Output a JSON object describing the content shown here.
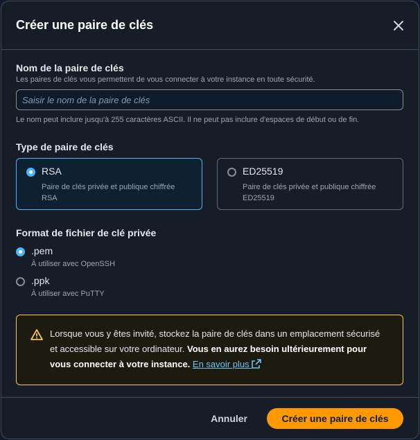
{
  "modal": {
    "title": "Créer une paire de clés"
  },
  "name_field": {
    "label": "Nom de la paire de clés",
    "description": "Les paires de clés vous permettent de vous connecter à votre instance en toute sécurité.",
    "placeholder": "Saisir le nom de la paire de clés",
    "value": "",
    "constraint": "Le nom peut inclure jusqu'à 255 caractères ASCII. Il ne peut pas inclure d'espaces de début ou de fin."
  },
  "key_type": {
    "label": "Type de paire de clés",
    "options": [
      {
        "title": "RSA",
        "desc_line1": "Paire de clés privée et publique chiffrée",
        "desc_line2": "RSA",
        "selected": true
      },
      {
        "title": "ED25519",
        "desc_line1": "Paire de clés privée et publique chiffrée",
        "desc_line2": "ED25519",
        "selected": false
      }
    ]
  },
  "file_format": {
    "label": "Format de fichier de clé privée",
    "options": [
      {
        "title": ".pem",
        "desc": "À utiliser avec OpenSSH",
        "selected": true
      },
      {
        "title": ".ppk",
        "desc": "À utiliser avec PuTTY",
        "selected": false
      }
    ]
  },
  "alert": {
    "text_normal": "Lorsque vous y êtes invité, stockez la paire de clés dans un emplacement sécurisé et accessible sur votre ordinateur.",
    "text_bold": "Vous en aurez besoin ultérieurement pour vous connecter à votre instance.",
    "link": "En savoir plus",
    "color": "#f2ca50"
  },
  "footer": {
    "cancel_label": "Annuler",
    "create_label": "Créer une paire de clés"
  },
  "colors": {
    "accent": "#4bb8f5",
    "primary_button": "#ff9900",
    "background": "#161d26"
  }
}
